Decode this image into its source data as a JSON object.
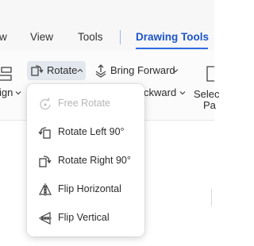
{
  "menubar": {
    "tabs": [
      {
        "label": "w",
        "active": false
      },
      {
        "label": "View",
        "active": false
      },
      {
        "label": "Tools",
        "active": false
      },
      {
        "label": "Drawing Tools",
        "active": true
      }
    ]
  },
  "ribbon": {
    "align_label": "ign",
    "rotate_label": "Rotate",
    "bring_forward_label": "Bring Forward",
    "send_backward_label": "ckward",
    "selection_pane_label_1": "Selec",
    "selection_pane_label_2": "Pa"
  },
  "rotate_menu": {
    "items": [
      {
        "label": "Free Rotate",
        "icon": "free-rotate-icon",
        "enabled": false
      },
      {
        "label": "Rotate Left 90°",
        "icon": "rotate-left-icon",
        "enabled": true
      },
      {
        "label": "Rotate Right 90°",
        "icon": "rotate-right-icon",
        "enabled": true
      },
      {
        "label": "Flip Horizontal",
        "icon": "flip-horizontal-icon",
        "enabled": true
      },
      {
        "label": "Flip Vertical",
        "icon": "flip-vertical-icon",
        "enabled": true
      }
    ]
  },
  "colors": {
    "accent": "#1d55c9",
    "underline": "#2f6be0",
    "disabled_text": "#b5b5b5"
  }
}
